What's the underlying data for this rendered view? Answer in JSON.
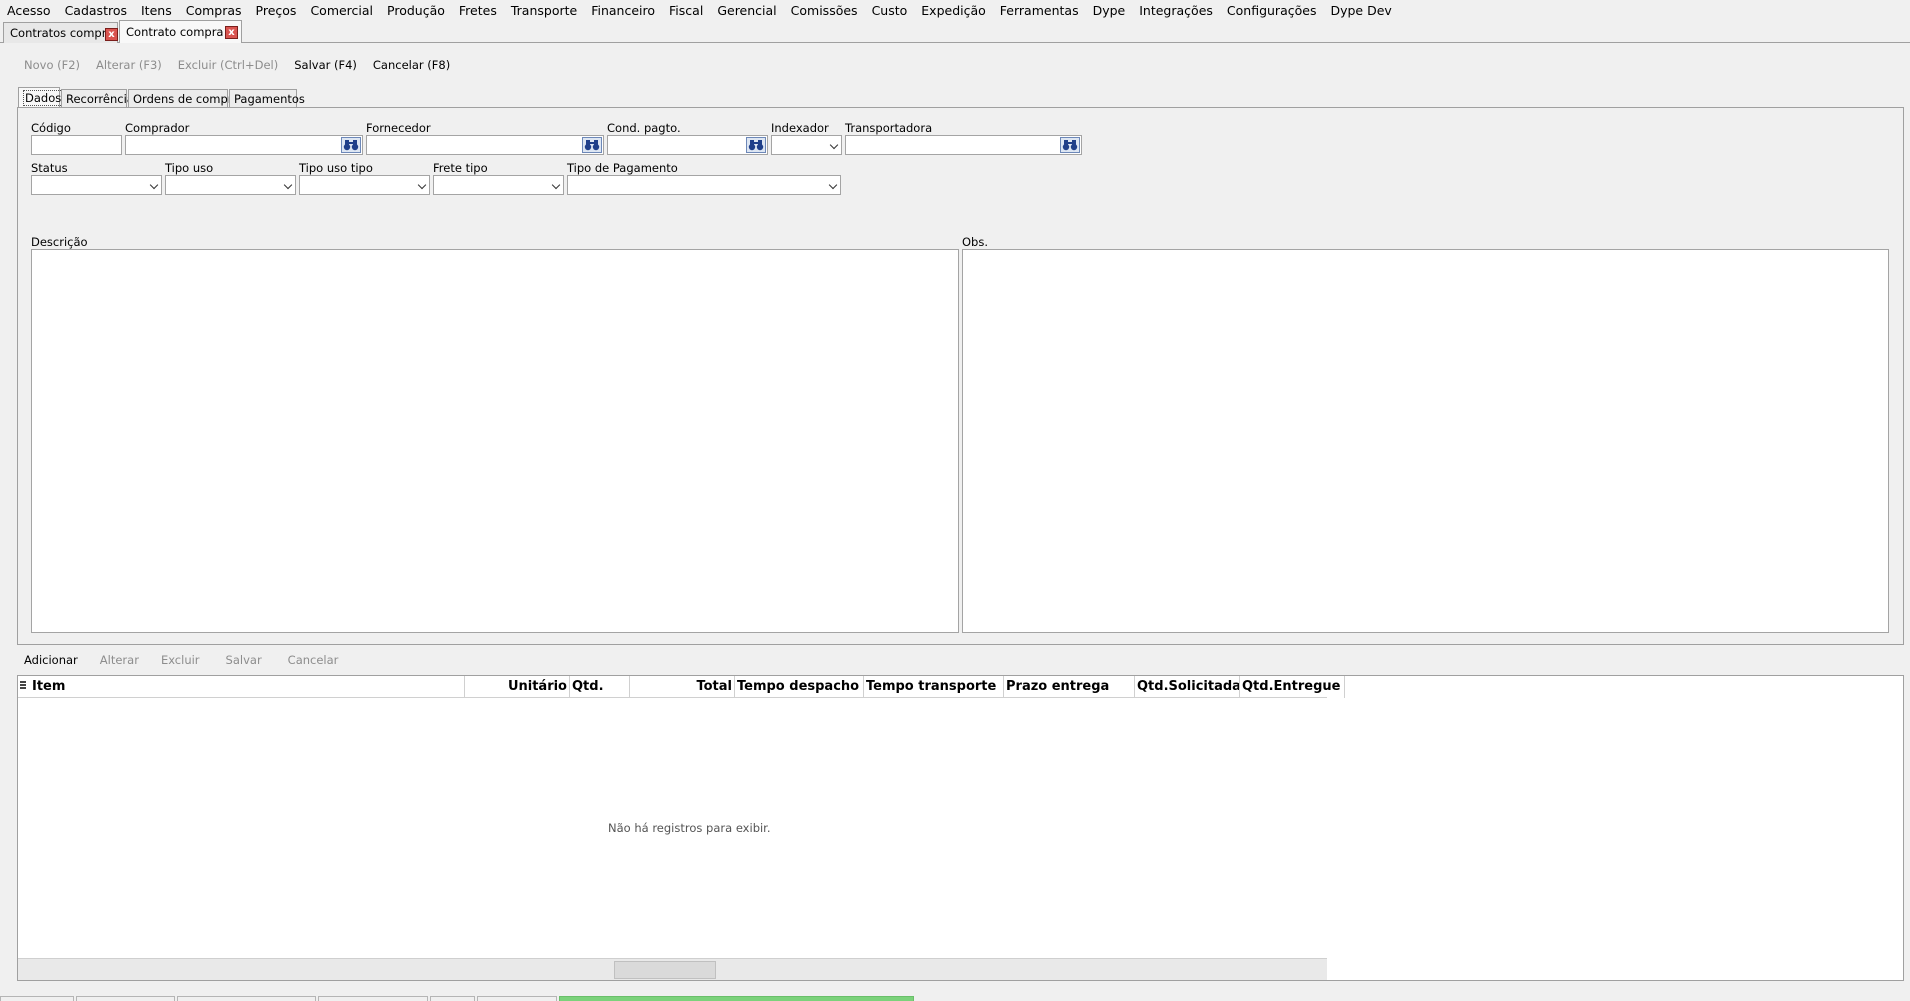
{
  "menu": [
    "Acesso",
    "Cadastros",
    "Itens",
    "Compras",
    "Preços",
    "Comercial",
    "Produção",
    "Fretes",
    "Transporte",
    "Financeiro",
    "Fiscal",
    "Gerencial",
    "Comissões",
    "Custo",
    "Expedição",
    "Ferramentas",
    "Dype",
    "Integrações",
    "Configurações",
    "Dype Dev"
  ],
  "doc_tabs": [
    {
      "label": "Contratos compra"
    },
    {
      "label": "Contrato compra ()"
    }
  ],
  "close_glyph": "x",
  "toolbar": {
    "novo": "Novo (F2)",
    "alterar": "Alterar (F3)",
    "excluir": "Excluir (Ctrl+Del)",
    "salvar": "Salvar (F4)",
    "cancelar": "Cancelar (F8)"
  },
  "inner_tabs": [
    "Dados",
    "Recorrência",
    "Ordens de compra",
    "Pagamentos"
  ],
  "form": {
    "codigo": {
      "label": "Código",
      "value": ""
    },
    "comprador": {
      "label": "Comprador",
      "value": ""
    },
    "fornecedor": {
      "label": "Fornecedor",
      "value": ""
    },
    "cond_pagto": {
      "label": "Cond. pagto.",
      "value": ""
    },
    "indexador": {
      "label": "Indexador",
      "value": ""
    },
    "transportadora": {
      "label": "Transportadora",
      "value": ""
    },
    "status": {
      "label": "Status",
      "value": ""
    },
    "tipo_uso": {
      "label": "Tipo uso",
      "value": ""
    },
    "tipo_uso_tipo": {
      "label": "Tipo uso tipo",
      "value": ""
    },
    "frete_tipo": {
      "label": "Frete tipo",
      "value": ""
    },
    "tipo_pagamento": {
      "label": "Tipo de Pagamento",
      "value": ""
    },
    "descricao": {
      "label": "Descrição",
      "value": ""
    },
    "obs": {
      "label": "Obs.",
      "value": ""
    }
  },
  "items_toolbar": {
    "adicionar": "Adicionar",
    "alterar": "Alterar",
    "excluir": "Excluir",
    "salvar": "Salvar",
    "cancelar": "Cancelar"
  },
  "grid": {
    "columns": [
      "Item",
      "Unitário",
      "Qtd.",
      "Total",
      "Tempo despacho",
      "Tempo transporte",
      "Prazo entrega",
      "Qtd.Solicitada",
      "Qtd.Entregue"
    ],
    "empty_message": "Não há registros para exibir."
  },
  "colors": {
    "close_red": "#d9534f",
    "lookup_blue": "#dde6f3",
    "status_green": "#7bd27b"
  }
}
